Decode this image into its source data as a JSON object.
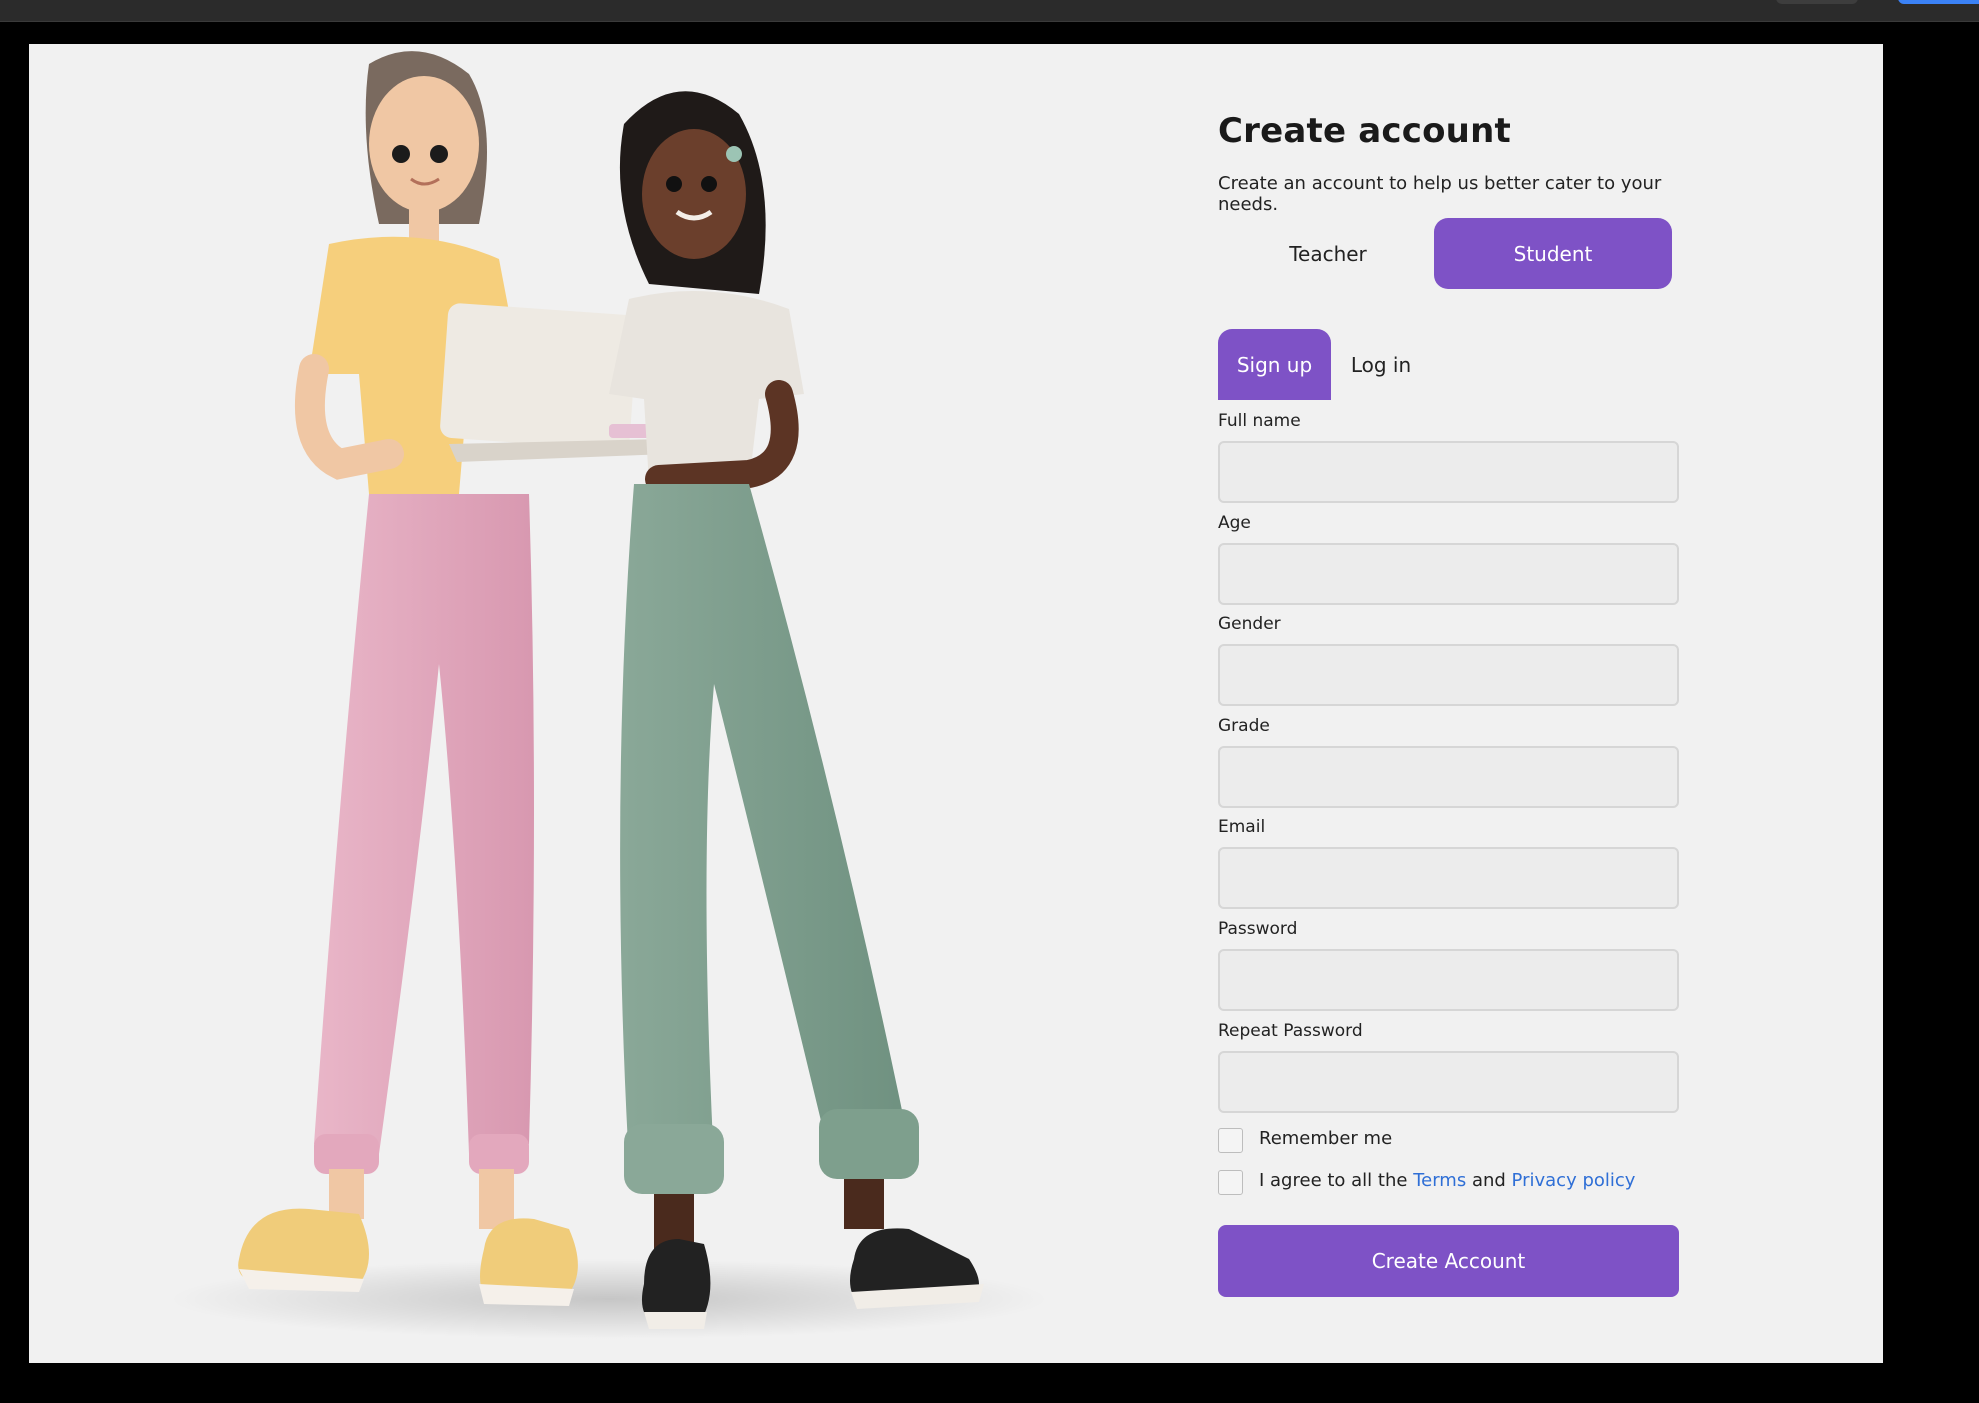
{
  "form": {
    "title": "Create account",
    "subtitle": "Create an account to help us better cater to your needs.",
    "roles": {
      "teacher": "Teacher",
      "student": "Student",
      "selected": "Student"
    },
    "tabs": {
      "signup": "Sign up",
      "login": "Log in",
      "active": "Sign up"
    },
    "fields": [
      {
        "label": "Full name",
        "value": ""
      },
      {
        "label": "Age",
        "value": ""
      },
      {
        "label": "Gender",
        "value": ""
      },
      {
        "label": "Grade",
        "value": ""
      },
      {
        "label": "Email",
        "value": ""
      },
      {
        "label": "Password",
        "value": ""
      },
      {
        "label": "Repeat Password",
        "value": ""
      }
    ],
    "remember_label": "Remember me",
    "agree": {
      "prefix": "I agree to all the",
      "terms": "Terms",
      "and": "and",
      "privacy": "Privacy policy"
    },
    "submit_label": "Create Account"
  },
  "colors": {
    "accent": "#7e52c6",
    "link": "#2f6fd6",
    "background": "#f1f1f1"
  }
}
